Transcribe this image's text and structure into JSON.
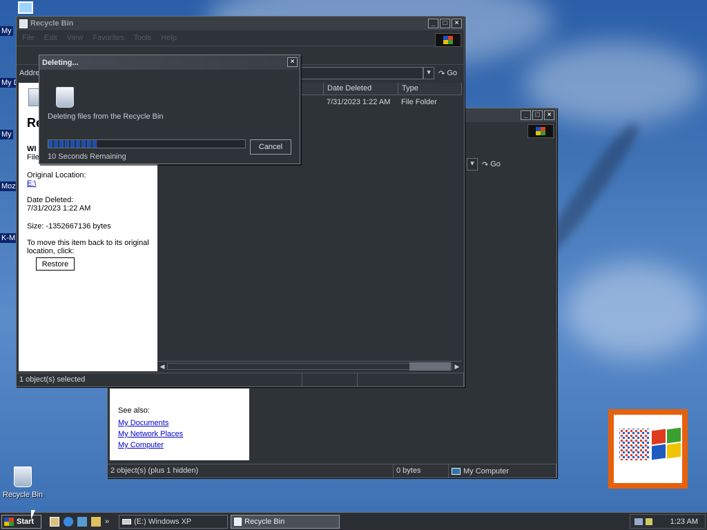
{
  "desktop": {
    "icons": [
      {
        "label": "My"
      },
      {
        "label": "My D"
      },
      {
        "label": "My"
      },
      {
        "label": "Moz"
      },
      {
        "label": "K-M"
      },
      {
        "label": "Recycle Bin"
      }
    ]
  },
  "back_window": {
    "address_go": "Go",
    "see_also_label": "See also:",
    "links": [
      "My Documents",
      "My Network Places",
      "My Computer"
    ],
    "status": {
      "objects": "2 object(s) (plus 1 hidden)",
      "size": "0 bytes",
      "zone": "My Computer"
    }
  },
  "main_window": {
    "title": "Recycle Bin",
    "menu": [
      "File",
      "Edit",
      "View",
      "Favorites",
      "Tools",
      "Help"
    ],
    "address_label": "Address",
    "address_go": "Go",
    "columns": {
      "date_deleted": "Date Deleted",
      "type": "Type"
    },
    "row": {
      "date_deleted": "7/31/2023 1:22 AM",
      "type": "File Folder"
    },
    "side_panel": {
      "header_initial": "Re",
      "item_name": "WI",
      "item_type": "File",
      "original_location_label": "Original Location:",
      "original_location": "E:\\",
      "date_deleted_label": "Date Deleted:",
      "date_deleted": "7/31/2023 1:22 AM",
      "size": "Size: -1352667136 bytes",
      "restore_hint": "To move this item back to its original location, click:",
      "restore_button": "Restore"
    },
    "status": {
      "selected": "1 object(s) selected"
    }
  },
  "dialog": {
    "title": "Deleting...",
    "message": "Deleting files from the Recycle Bin",
    "remaining": "10 Seconds Remaining",
    "cancel": "Cancel",
    "progress": 0.25
  },
  "taskbar": {
    "start": "Start",
    "tasks": [
      {
        "label": "(E:) Windows XP",
        "active": false
      },
      {
        "label": "Recycle Bin",
        "active": true
      }
    ],
    "clock": "1:23 AM",
    "quicklaunch_more": "»"
  }
}
